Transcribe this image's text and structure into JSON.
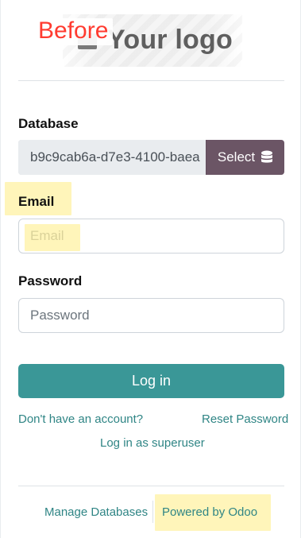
{
  "annotation": {
    "before_label": "Before"
  },
  "logo": {
    "text": "Your logo"
  },
  "database": {
    "label": "Database",
    "value": "b9c9cab6a-d7e3-4100-baea",
    "select_label": "Select",
    "select_icon": "database-icon"
  },
  "email": {
    "label": "Email",
    "placeholder": "Email"
  },
  "password": {
    "label": "Password",
    "placeholder": "Password"
  },
  "actions": {
    "login_label": "Log in",
    "signup_link": "Don't have an account?",
    "reset_password_link": "Reset Password",
    "superuser_link": "Log in as superuser"
  },
  "footer": {
    "manage_databases": "Manage Databases",
    "powered_by": "Powered by Odoo"
  },
  "colors": {
    "primary": "#3a9797",
    "select_button": "#6b5565",
    "link": "#2f8585",
    "highlight": "#fff1a3",
    "before_label": "#ff3b30"
  }
}
